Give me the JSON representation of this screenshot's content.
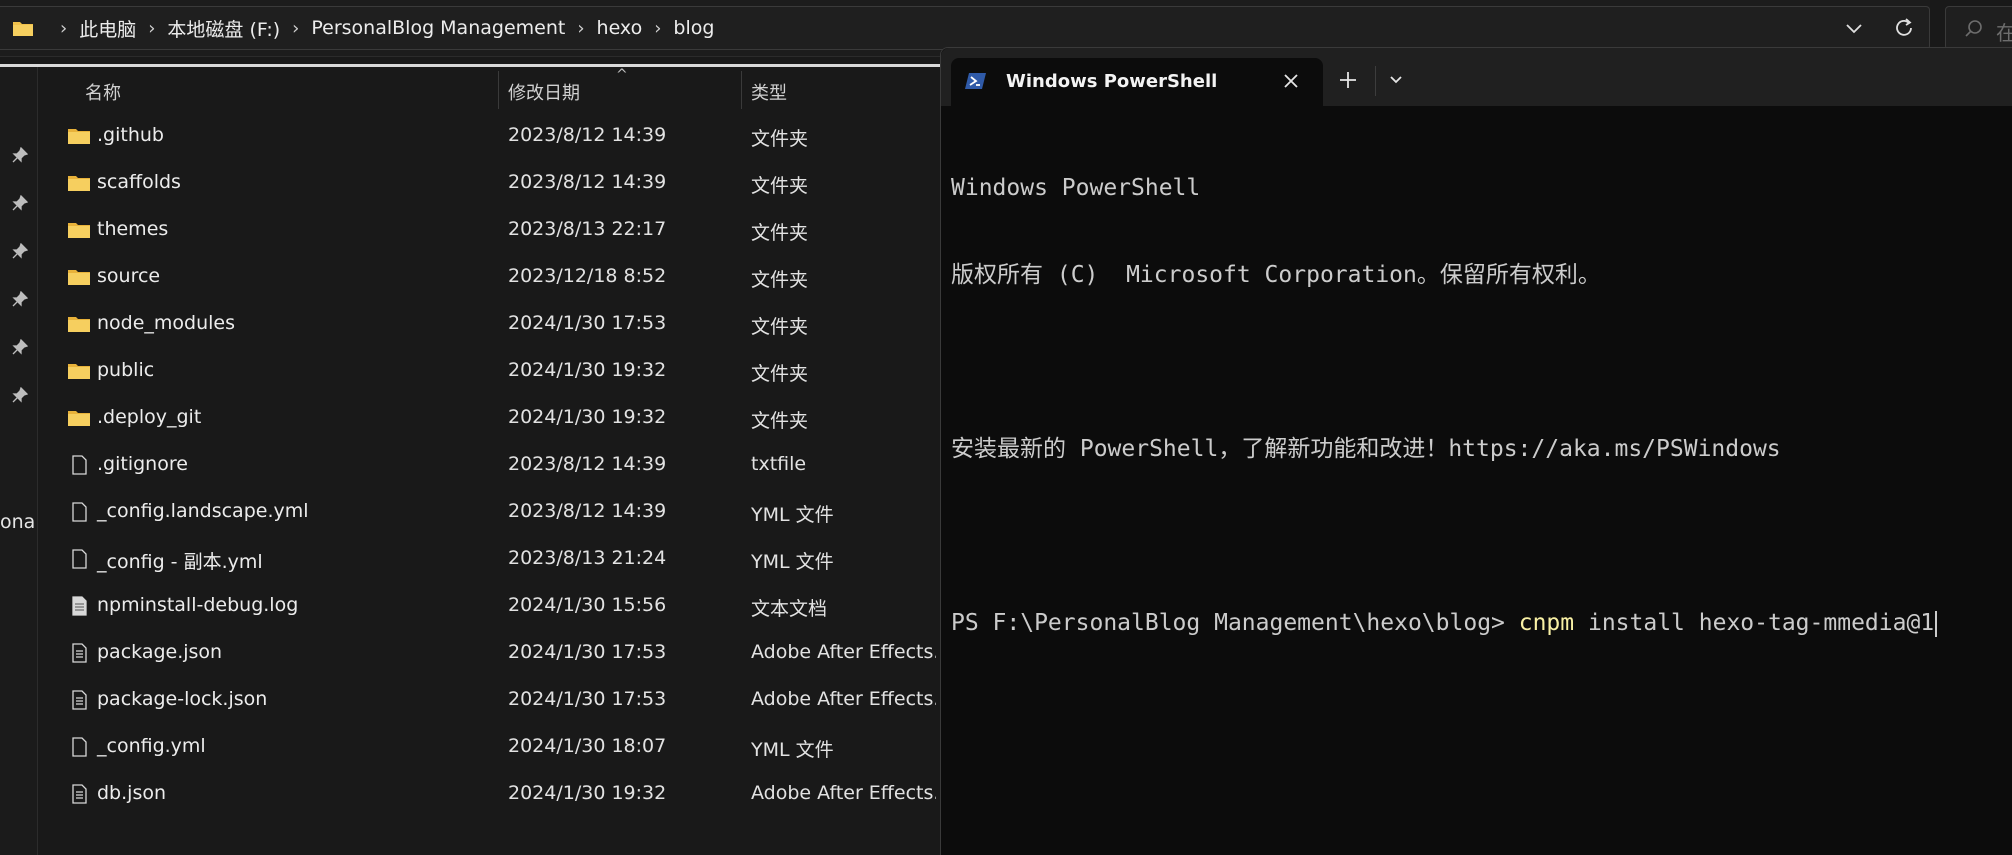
{
  "explorer": {
    "breadcrumbs": [
      "此电脑",
      "本地磁盘 (F:)",
      "PersonalBlog Management",
      "hexo",
      "blog"
    ],
    "search_placeholder": "在",
    "nav_cut_label": "onal",
    "columns": {
      "name": "名称",
      "modified": "修改日期",
      "type": "类型"
    },
    "files": [
      {
        "name": ".github",
        "modified": "2023/8/12 14:39",
        "type": "文件夹",
        "icon": "folder-icon"
      },
      {
        "name": "scaffolds",
        "modified": "2023/8/12 14:39",
        "type": "文件夹",
        "icon": "folder-icon"
      },
      {
        "name": "themes",
        "modified": "2023/8/13 22:17",
        "type": "文件夹",
        "icon": "folder-icon"
      },
      {
        "name": "source",
        "modified": "2023/12/18 8:52",
        "type": "文件夹",
        "icon": "folder-icon"
      },
      {
        "name": "node_modules",
        "modified": "2024/1/30 17:53",
        "type": "文件夹",
        "icon": "folder-icon"
      },
      {
        "name": "public",
        "modified": "2024/1/30 19:32",
        "type": "文件夹",
        "icon": "folder-icon"
      },
      {
        "name": ".deploy_git",
        "modified": "2024/1/30 19:32",
        "type": "文件夹",
        "icon": "folder-icon"
      },
      {
        "name": ".gitignore",
        "modified": "2023/8/12 14:39",
        "type": "txtfile",
        "icon": "file-icon"
      },
      {
        "name": "_config.landscape.yml",
        "modified": "2023/8/12 14:39",
        "type": "YML 文件",
        "icon": "file-icon"
      },
      {
        "name": "_config - 副本.yml",
        "modified": "2023/8/13 21:24",
        "type": "YML 文件",
        "icon": "file-icon"
      },
      {
        "name": "npminstall-debug.log",
        "modified": "2024/1/30 15:56",
        "type": "文本文档",
        "icon": "text-file-icon"
      },
      {
        "name": "package.json",
        "modified": "2024/1/30 17:53",
        "type": "Adobe After Effects...",
        "icon": "json-file-icon"
      },
      {
        "name": "package-lock.json",
        "modified": "2024/1/30 17:53",
        "type": "Adobe After Effects...",
        "icon": "json-file-icon"
      },
      {
        "name": "_config.yml",
        "modified": "2024/1/30 18:07",
        "type": "YML 文件",
        "icon": "file-icon"
      },
      {
        "name": "db.json",
        "modified": "2024/1/30 19:32",
        "type": "Adobe After Effects...",
        "icon": "json-file-icon"
      }
    ]
  },
  "terminal": {
    "tab_title": "Windows PowerShell",
    "lines": {
      "l1": "Windows PowerShell",
      "l2": "版权所有 (C)  Microsoft Corporation。保留所有权利。",
      "l3": "安装最新的 PowerShell，了解新功能和改进！https://aka.ms/PSWindows",
      "prompt": "PS F:\\PersonalBlog Management\\hexo\\blog> ",
      "cmd_name": "cnpm",
      "cmd_args": " install hexo-tag-mmedia@1"
    }
  },
  "colors": {
    "background": "#191919",
    "terminal_bg": "#0c0c0c",
    "folder": "#f0c14b",
    "command": "#f9f1a5",
    "powershell_icon": "#2f5aa8"
  }
}
